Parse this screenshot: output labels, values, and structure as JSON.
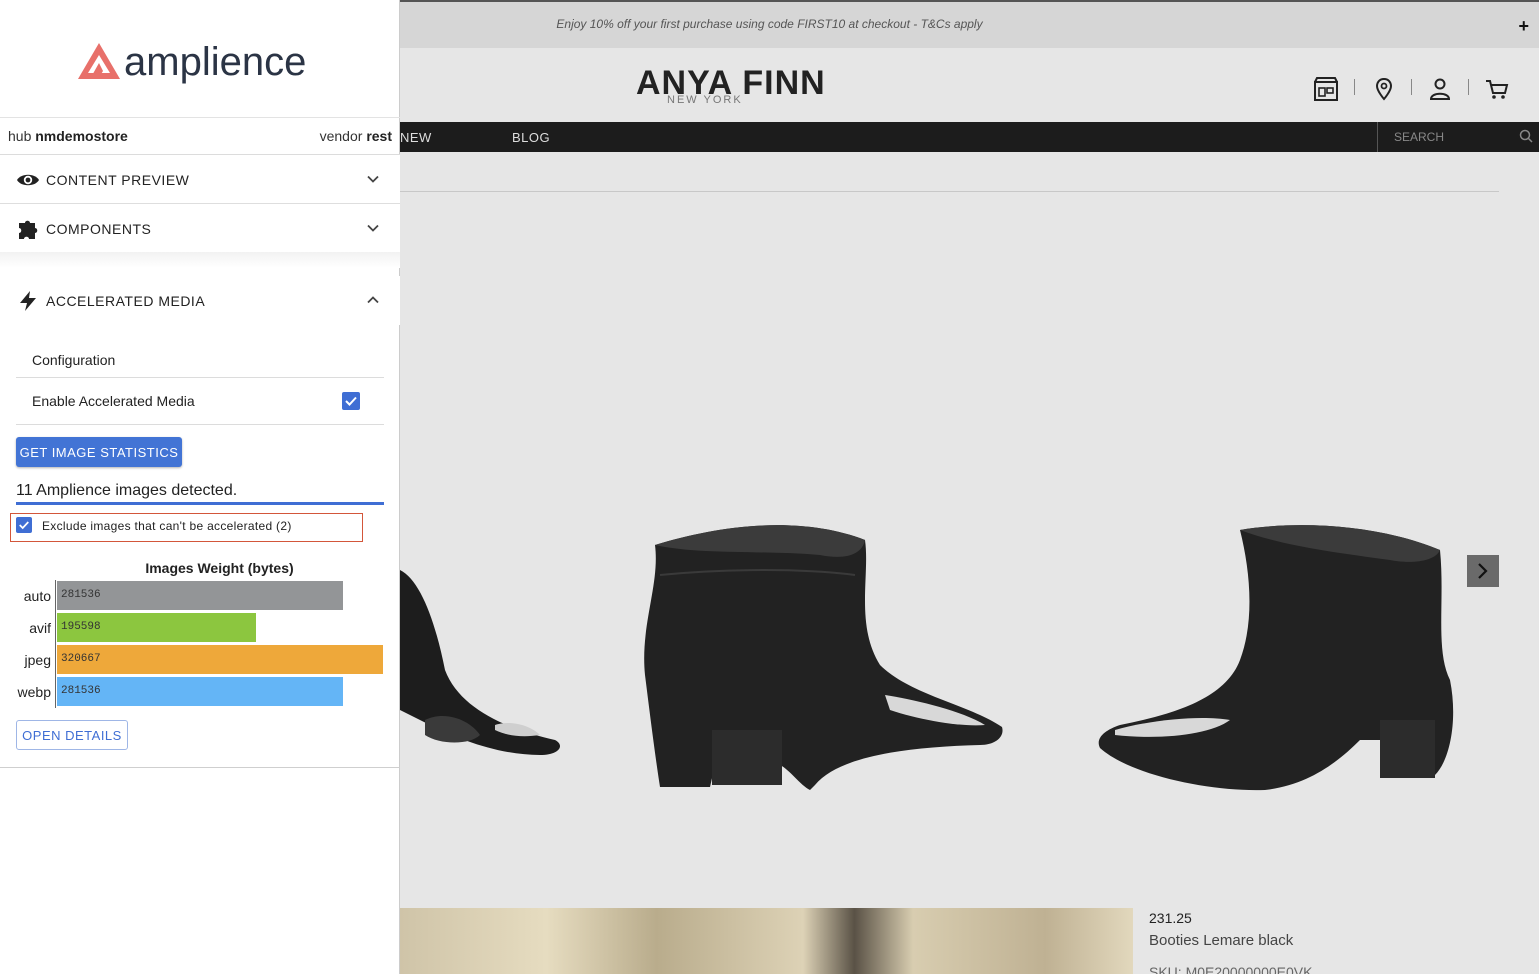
{
  "store": {
    "promo_text": "Enjoy 10% off your first purchase using code FIRST10 at checkout - T&Cs apply",
    "promo_plus": "+",
    "logo_main": "ANYA FINN",
    "logo_sub": "NEW YORK",
    "nav": [
      "NEW",
      "BLOG"
    ],
    "search_placeholder": "SEARCH",
    "product": {
      "price": "231.25",
      "name": "Booties Lemare black",
      "sku": "SKU: M0E20000000E0VK"
    }
  },
  "panel": {
    "brand": "amplience",
    "hub_label": "hub",
    "hub_value": "nmdemostore",
    "vendor_label": "vendor",
    "vendor_value": "rest",
    "sections": {
      "content_preview": "CONTENT PREVIEW",
      "components": "COMPONENTS",
      "accelerated_media": "ACCELERATED MEDIA"
    },
    "config_title": "Configuration",
    "enable_label": "Enable Accelerated Media",
    "enable_checked": true,
    "get_stats_button": "GET IMAGE STATISTICS",
    "detected_text": "11 Amplience images detected.",
    "exclude_label": "Exclude images that can't be accelerated (2)",
    "exclude_checked": true,
    "open_details_button": "OPEN DETAILS"
  },
  "chart_data": {
    "type": "bar",
    "orientation": "horizontal",
    "title": "Images Weight (bytes)",
    "categories": [
      "auto",
      "avif",
      "jpeg",
      "webp"
    ],
    "values": [
      281536,
      195598,
      320667,
      281536
    ],
    "value_labels": [
      "281536",
      "195598",
      "320667",
      "281536"
    ],
    "colors": [
      "#939597",
      "#8cc63f",
      "#eea83a",
      "#64b5f6"
    ],
    "xlim": [
      0,
      320667
    ]
  }
}
